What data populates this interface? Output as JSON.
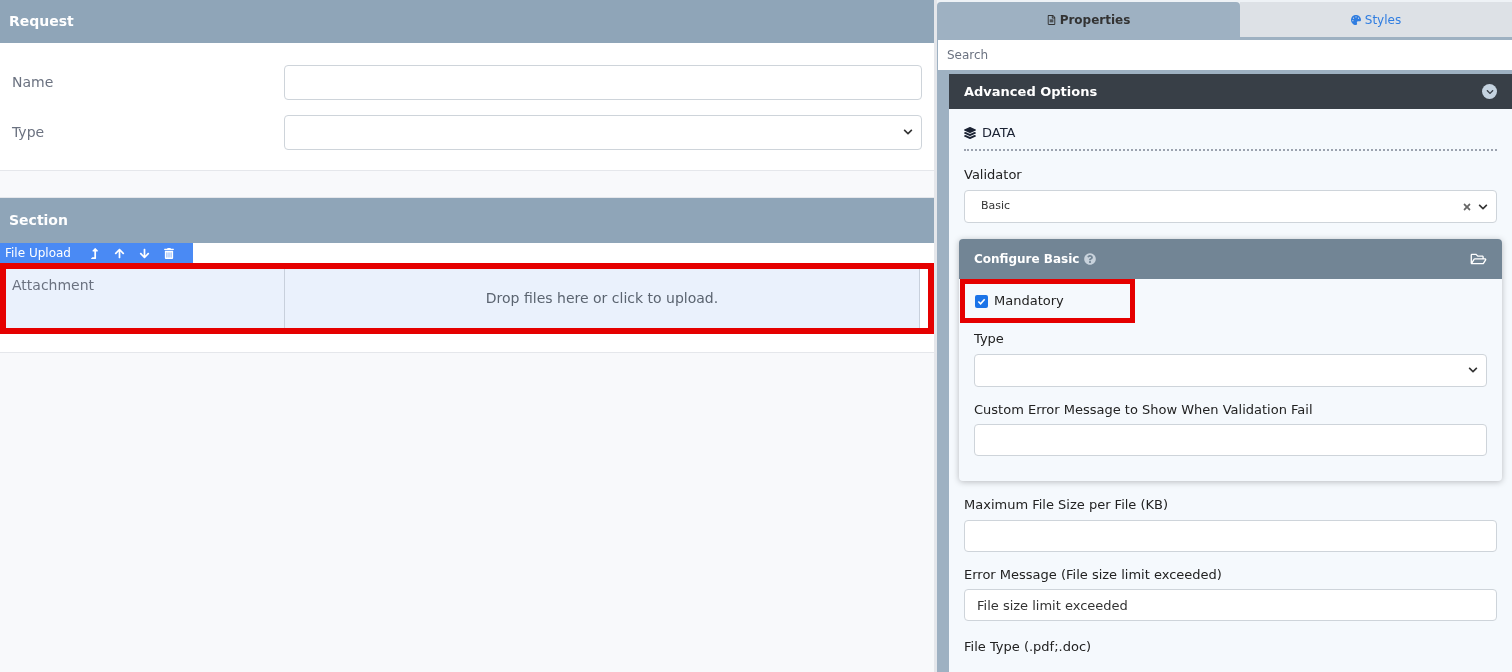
{
  "form": {
    "sections": [
      {
        "title": "Request",
        "fields": [
          {
            "kind": "text",
            "label": "Name"
          },
          {
            "kind": "select",
            "label": "Type"
          }
        ]
      },
      {
        "title": "Section",
        "toolbar": {
          "label": "File Upload"
        },
        "fields": [
          {
            "kind": "upload",
            "label": "Attachment",
            "hint": "Drop files here or click to upload.",
            "highlighted": true
          }
        ]
      }
    ]
  },
  "panel": {
    "tabs": [
      {
        "label": "Properties",
        "selected": true
      },
      {
        "label": "Styles",
        "selected": false
      }
    ],
    "search": {
      "placeholder": "Search"
    },
    "accordion": {
      "title": "Advanced Options",
      "expanded": true
    },
    "group": {
      "title": "DATA"
    },
    "validator": {
      "label": "Validator",
      "value": "Basic"
    },
    "configure": {
      "title": "Configure Basic",
      "checkbox": {
        "label": "Mandatory",
        "checked": true,
        "highlighted": true
      },
      "fields": [
        {
          "kind": "select",
          "label": "Type"
        },
        {
          "kind": "text",
          "label": "Custom Error Message to Show When Validation Fail"
        }
      ]
    },
    "fields": [
      {
        "kind": "text",
        "label": "Maximum File Size per File (KB)"
      },
      {
        "kind": "text",
        "label": "Error Message (File size limit exceeded)",
        "value": "File size limit exceeded"
      },
      {
        "kind": "label",
        "label": "File Type (.pdf;.doc)"
      }
    ]
  }
}
